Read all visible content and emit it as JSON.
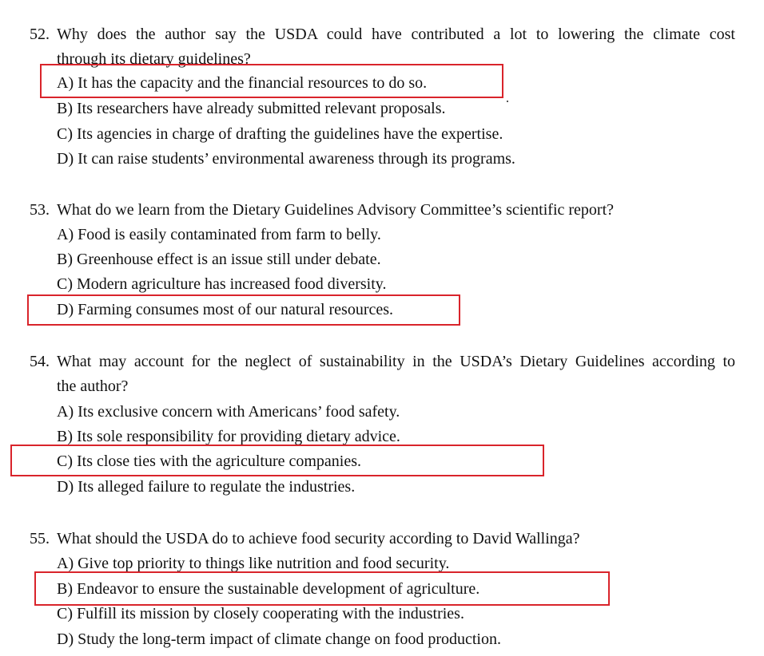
{
  "questions": [
    {
      "number": "52.",
      "text_line1": "Why does the author say the USDA could have contributed a lot to lowering the climate cost",
      "text_line2": "through its dietary guidelines?",
      "options": [
        "A) It has the capacity and the financial resources to do so.",
        "B) Its researchers have already submitted relevant proposals.",
        "C) Its agencies in charge of drafting the guidelines have the expertise.",
        "D) It can raise students’ environmental awareness through its programs."
      ],
      "highlighted_option": "A"
    },
    {
      "number": "53.",
      "text_line1": "What do we learn from the Dietary Guidelines Advisory Committee’s scientific report?",
      "options": [
        "A) Food is easily contaminated from farm to belly.",
        "B) Greenhouse effect is an issue still under debate.",
        "C) Modern agriculture has increased food diversity.",
        "D) Farming consumes most of our natural resources."
      ],
      "highlighted_option": "D"
    },
    {
      "number": "54.",
      "text_line1": "What may account for the neglect of sustainability in the USDA’s Dietary Guidelines according to",
      "text_line2": "the author?",
      "options": [
        "A) Its exclusive concern with Americans’ food safety.",
        "B) Its sole responsibility for providing dietary advice.",
        "C) Its close ties with the agriculture companies.",
        "D) Its alleged failure to regulate the industries."
      ],
      "highlighted_option": "C"
    },
    {
      "number": "55.",
      "text_line1": "What should the USDA do to achieve food security according to David Wallinga?",
      "options": [
        "A) Give top priority to things like nutrition and food security.",
        "B) Endeavor to ensure the sustainable development of agriculture.",
        "C) Fulfill its mission by closely cooperating with the industries.",
        "D) Study the long-term impact of climate change on food production."
      ],
      "highlighted_option": "B"
    }
  ],
  "colors": {
    "highlight_box": "#d9242b",
    "text": "#111111"
  }
}
